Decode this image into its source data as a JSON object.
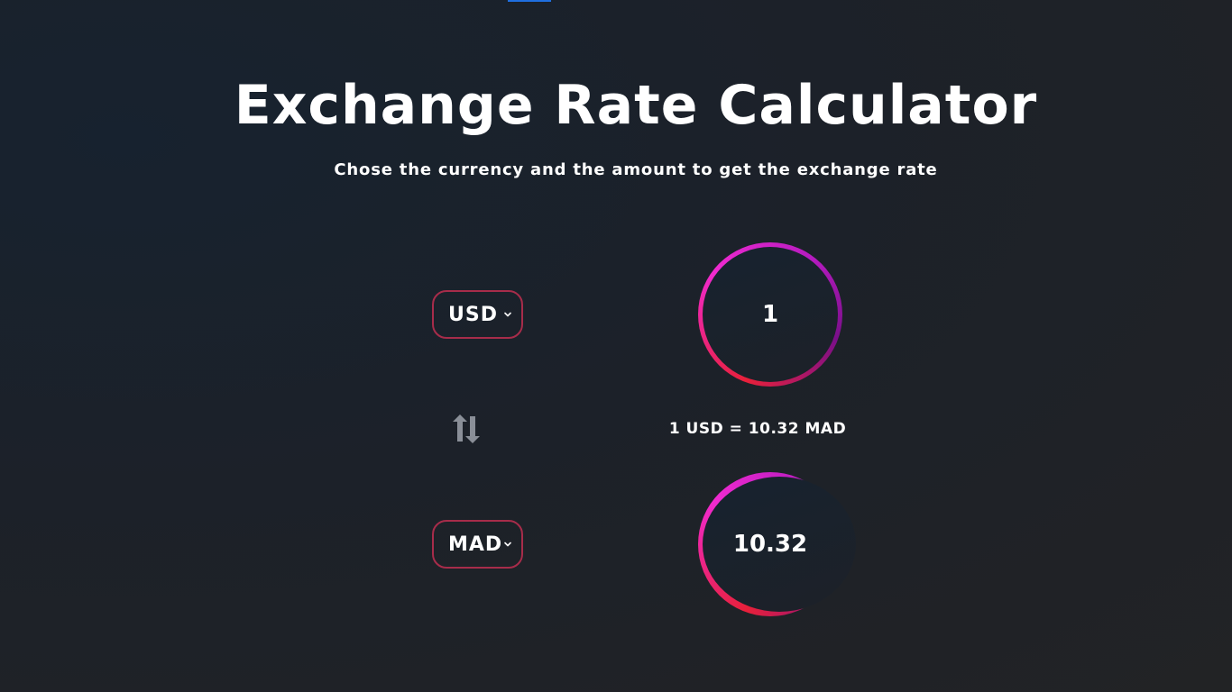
{
  "header": {
    "title": "Exchange Rate Calculator",
    "subtitle": "Chose the currency and the amount to get the exchange rate"
  },
  "from": {
    "currency": "USD",
    "amount": "1"
  },
  "to": {
    "currency": "MAD",
    "amount": "10.32"
  },
  "rate": {
    "text": "1 USD = 10.32 MAD"
  },
  "icons": {
    "swap": "swap-arrows-icon",
    "dropdown": "chevron-down-icon"
  },
  "colors": {
    "select_border": "#a72c4a",
    "ring_red": "#e8203a",
    "ring_pink": "#f02ad0",
    "ring_purple": "#7a0f8a",
    "accent_blue": "#1f6fe0"
  }
}
